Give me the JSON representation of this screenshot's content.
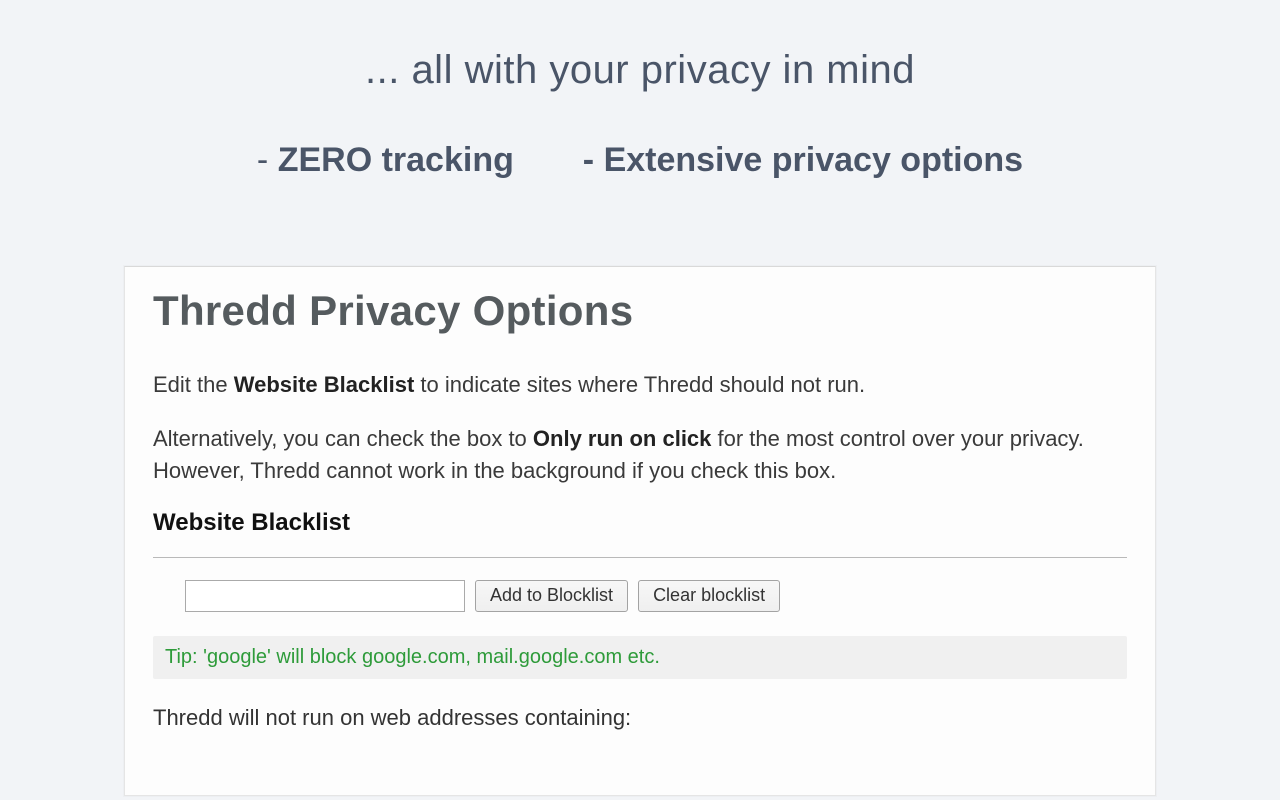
{
  "header": {
    "title": "... all with your privacy in mind",
    "bullet1_dash": "- ",
    "bullet1_text": "ZERO tracking",
    "bullet2_dash": "- ",
    "bullet2_text": "Extensive privacy options"
  },
  "panel": {
    "heading": "Thredd Privacy Options",
    "desc1_pre": "Edit the ",
    "desc1_bold": "Website Blacklist",
    "desc1_post": " to indicate sites where Thredd should not run.",
    "desc2_pre": "Alternatively, you can check the box to ",
    "desc2_bold": "Only run on click",
    "desc2_post": " for the most control over your privacy. However, Thredd cannot work in the background if you check this box.",
    "section_title": "Website Blacklist",
    "input_value": "",
    "add_button": "Add to Blocklist",
    "clear_button": "Clear blocklist",
    "tip": "Tip: 'google' will block google.com, mail.google.com etc.",
    "final_text": "Thredd will not run on web addresses containing:"
  }
}
